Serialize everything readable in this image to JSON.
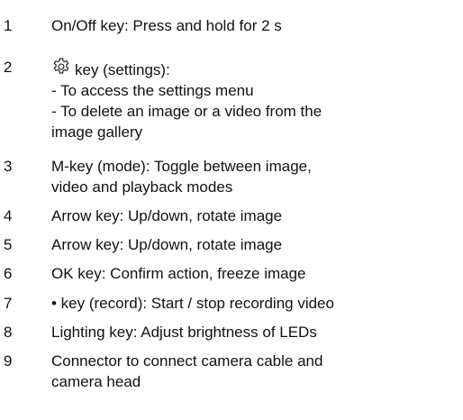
{
  "items": [
    {
      "number": "1",
      "lines": [
        "On/Off key: Press and hold for 2 s"
      ]
    },
    {
      "number": "2",
      "icon": "gear-settings-icon",
      "lines": [
        "key (settings):",
        "- To access the settings menu",
        "- To delete an image or a video from the",
        "image gallery"
      ]
    },
    {
      "number": "3",
      "lines": [
        "M-key (mode): Toggle between image,",
        "video and playback modes"
      ]
    },
    {
      "number": "4",
      "lines": [
        "Arrow key: Up/down, rotate image"
      ]
    },
    {
      "number": "5",
      "lines": [
        "Arrow key: Up/down, rotate image"
      ]
    },
    {
      "number": "6",
      "lines": [
        "OK key: Confirm action, freeze image"
      ]
    },
    {
      "number": "7",
      "lines": [
        "• key (record): Start / stop recording video"
      ]
    },
    {
      "number": "8",
      "lines": [
        "Lighting key: Adjust brightness of LEDs"
      ]
    },
    {
      "number": "9",
      "lines": [
        "Connector to connect camera cable and",
        "camera head"
      ]
    }
  ]
}
